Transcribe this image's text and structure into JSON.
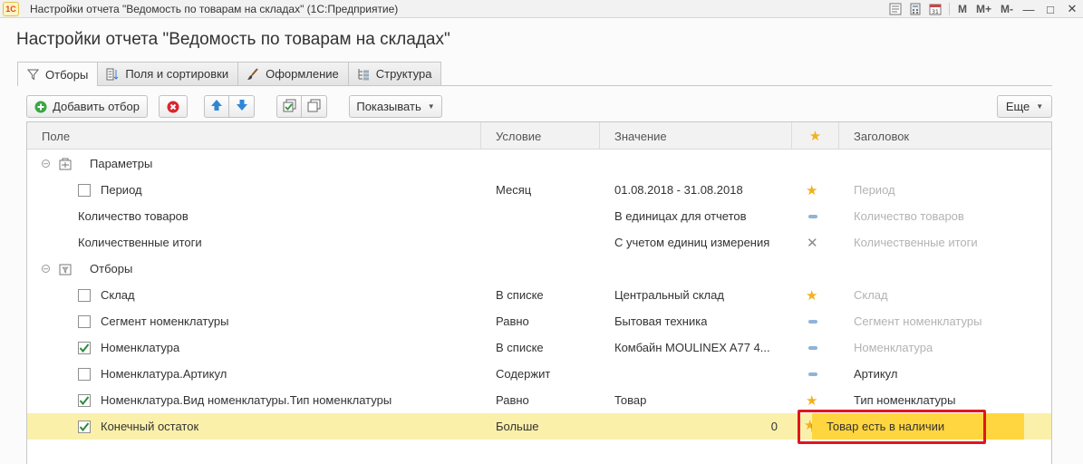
{
  "window": {
    "title": "Настройки отчета \"Ведомость по товарам на складах\"  (1С:Предприятие)",
    "logo_text": "1С",
    "right_labels": [
      "M",
      "M+",
      "M-"
    ]
  },
  "form": {
    "title": "Настройки отчета \"Ведомость по товарам на складах\""
  },
  "tabs": [
    {
      "label": "Отборы",
      "icon": "filter-icon",
      "active": true
    },
    {
      "label": "Поля и сортировки",
      "icon": "fields-sort-icon",
      "active": false
    },
    {
      "label": "Оформление",
      "icon": "brush-icon",
      "active": false
    },
    {
      "label": "Структура",
      "icon": "structure-icon",
      "active": false
    }
  ],
  "toolbar": {
    "add_filter_label": "Добавить отбор",
    "show_label": "Показывать",
    "more_label": "Еще"
  },
  "grid": {
    "columns": [
      "Поле",
      "Условие",
      "Значение",
      "★",
      "Заголовок"
    ],
    "rows": [
      {
        "type": "group",
        "field": "Параметры"
      },
      {
        "type": "item",
        "checkbox": true,
        "checked": false,
        "field": "Период",
        "condition": "Месяц",
        "value": "01.08.2018 - 31.08.2018",
        "mark": "star",
        "title": "Период",
        "title_muted": true
      },
      {
        "type": "item",
        "checkbox": false,
        "field": "Количество товаров",
        "condition": "",
        "value": "В единицах для отчетов",
        "mark": "dash",
        "title": "Количество товаров",
        "title_muted": true
      },
      {
        "type": "item",
        "checkbox": false,
        "field": "Количественные итоги",
        "condition": "",
        "value": "С учетом единиц измерения",
        "mark": "x",
        "title": "Количественные итоги",
        "title_muted": true
      },
      {
        "type": "group",
        "field": "Отборы"
      },
      {
        "type": "item",
        "checkbox": true,
        "checked": false,
        "field": "Склад",
        "condition": "В списке",
        "value": "Центральный склад",
        "mark": "star",
        "title": "Склад",
        "title_muted": true
      },
      {
        "type": "item",
        "checkbox": true,
        "checked": false,
        "field": "Сегмент номенклатуры",
        "condition": "Равно",
        "value": "Бытовая техника",
        "mark": "dash",
        "title": "Сегмент номенклатуры",
        "title_muted": true
      },
      {
        "type": "item",
        "checkbox": true,
        "checked": true,
        "field": "Номенклатура",
        "condition": "В списке",
        "value": "Комбайн MOULINEX  A77 4...",
        "mark": "dash",
        "title": "Номенклатура",
        "title_muted": true
      },
      {
        "type": "item",
        "checkbox": true,
        "checked": false,
        "field": "Номенклатура.Артикул",
        "condition": "Содержит",
        "value": "",
        "mark": "dash",
        "title": "Артикул",
        "title_muted": false
      },
      {
        "type": "item",
        "checkbox": true,
        "checked": true,
        "field": "Номенклатура.Вид номенклатуры.Тип номенклатуры",
        "condition": "Равно",
        "value": "Товар",
        "mark": "star",
        "title": "Тип номенклатуры",
        "title_muted": false
      },
      {
        "type": "item",
        "checkbox": true,
        "checked": true,
        "field": "Конечный остаток",
        "condition": "Больше",
        "value": "0",
        "value_align": "right",
        "mark": "star-check",
        "title": "Товар есть в наличии",
        "title_muted": false,
        "selected": true
      }
    ]
  },
  "colors": {
    "selected_row": "#fbf0aa",
    "active_title_cell": "#ffd63f",
    "callout_frame": "#e0161e",
    "star": "#f2b11e"
  }
}
